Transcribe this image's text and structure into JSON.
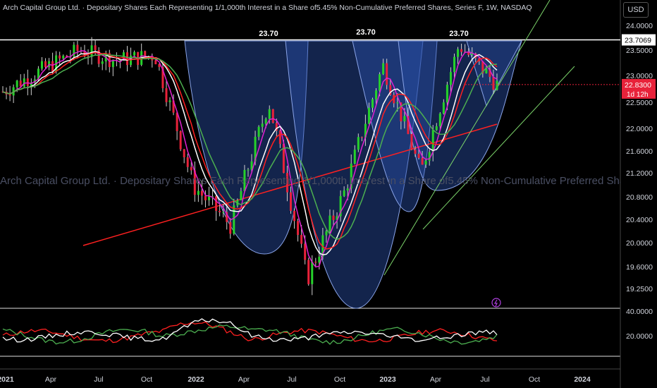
{
  "header": {
    "title": "Arch Capital Group Ltd. · Depositary Shares Each Representing 1/1,000th Interest in a Share of5.45% Non-Cumulative Preferred Shares, Series F, 1W, NASDAQ",
    "currency": "USD",
    "watermark": "Arch Capital Group Ltd. · Depositary Shares Each Representing 1/1,000th Interest in a Share of5.45% Non-Cumulative Preferred Shares, Series F"
  },
  "colors": {
    "up": "#26d12b",
    "down": "#e8223a",
    "ma_white": "#ffffff",
    "ma_magenta": "#e020d0",
    "ma_red": "#ff2020",
    "ma_green": "#4caf50",
    "resistance": "#ffffff",
    "cup_fill": "#2a4fa8",
    "trendline": "#7bd36a",
    "trend_red": "#ff2020"
  },
  "chart_data": [
    {
      "type": "candlestick",
      "interval": "1W",
      "y_axis_labels": [
        "24.0000",
        "23.5000",
        "23.0000",
        "22.5000",
        "22.0000",
        "21.6000",
        "21.2000",
        "20.8000",
        "20.4000",
        "20.0000",
        "19.6000",
        "19.2500"
      ],
      "x_axis_labels": [
        "2021",
        "Apr",
        "Jul",
        "Oct",
        "2022",
        "Apr",
        "Jul",
        "Oct",
        "2023",
        "Apr",
        "Jul",
        "Oct",
        "2024"
      ],
      "resistance_level": 23.7069,
      "resistance_label": "23.7069",
      "last_price": "22.8300",
      "countdown": "1d 12h",
      "peak_labels": [
        "23.70",
        "23.70",
        "23.70"
      ],
      "ohlc_close_approx": [
        {
          "period": "2021-01",
          "close": 22.7
        },
        {
          "period": "2021-04",
          "close": 23.1
        },
        {
          "period": "2021-07",
          "close": 23.5
        },
        {
          "period": "2021-10",
          "close": 23.3
        },
        {
          "period": "2022-01",
          "close": 23.4
        },
        {
          "period": "2022-04",
          "close": 21.0
        },
        {
          "period": "2022-05",
          "close": 20.3
        },
        {
          "period": "2022-07",
          "close": 22.5
        },
        {
          "period": "2022-10",
          "close": 19.4
        },
        {
          "period": "2022-11",
          "close": 20.9
        },
        {
          "period": "2023-01",
          "close": 23.2
        },
        {
          "period": "2023-03",
          "close": 21.2
        },
        {
          "period": "2023-05",
          "close": 23.6
        },
        {
          "period": "2023-07",
          "close": 22.83
        }
      ]
    },
    {
      "type": "line",
      "name": "oscillator",
      "y_axis_labels": [
        "40.0000",
        "20.0000"
      ]
    }
  ]
}
